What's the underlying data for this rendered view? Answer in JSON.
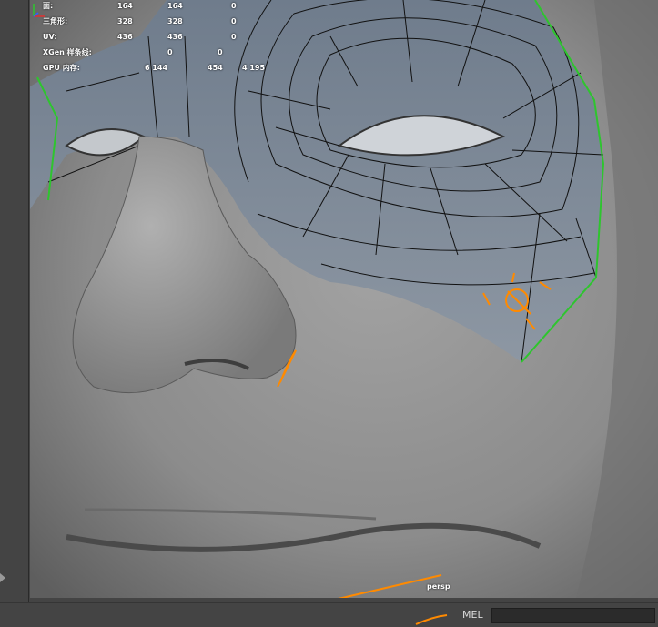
{
  "hud": {
    "rows": [
      {
        "label": "面:",
        "v1": "164",
        "v2": "164",
        "v3": "0"
      },
      {
        "label": "三角形:",
        "v1": "328",
        "v2": "328",
        "v3": "0"
      },
      {
        "label": "UV:",
        "v1": "436",
        "v2": "436",
        "v3": "0"
      },
      {
        "label": "XGen 样条线:",
        "v1": "0",
        "v2": "0",
        "v3": ""
      },
      {
        "label": "GPU 内存:",
        "v1": "6 144",
        "v2": "454",
        "v3": "4 195"
      }
    ]
  },
  "viewport": {
    "camera_label": "persp",
    "icons": [
      "axis-gizmo-icon"
    ]
  },
  "command_line": {
    "mode_label": "MEL",
    "input_value": ""
  },
  "colors": {
    "background": "#444444",
    "mesh_green": "#2ec52e",
    "annotation_orange": "#ff8a00"
  }
}
